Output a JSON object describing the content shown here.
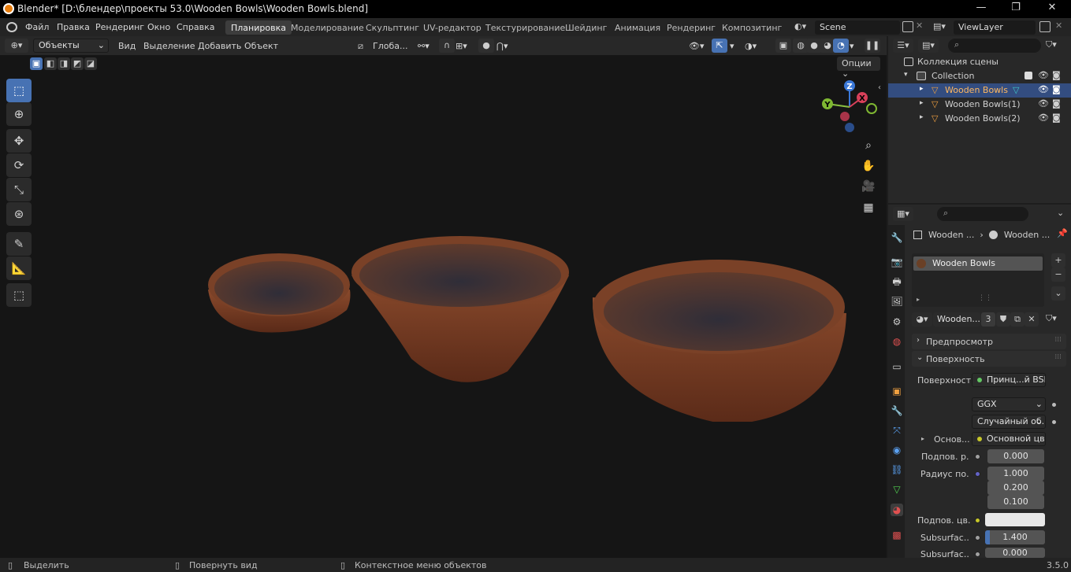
{
  "window": {
    "title": "Blender* [D:\\блендер\\проекты 53.0\\Wooden Bowls\\Wooden Bowls.blend]",
    "minimize": "—",
    "maximize": "❐",
    "close": "✕"
  },
  "menu": [
    "Файл",
    "Правка",
    "Рендеринг",
    "Окно",
    "Справка"
  ],
  "workspaces": [
    "Планировка",
    "Моделирование",
    "Скульптинг",
    "UV-редактор",
    "Текстурирование",
    "Шейдинг",
    "Анимация",
    "Рендеринг",
    "Композитинг"
  ],
  "active_workspace": "Планировка",
  "scene": {
    "name": "Scene",
    "viewlayer": "ViewLayer"
  },
  "viewport": {
    "mode": "Объекты",
    "menus": [
      "Вид",
      "Выделение",
      "Добавить",
      "Объект"
    ],
    "transform_orientation": "Глоба...",
    "options": "Опции",
    "gizmo": {
      "x": "X",
      "y": "Y",
      "z": "Z"
    },
    "bowl_colors": {
      "rim": "#7a4127",
      "inside": "#3e3640",
      "shadow": "#4a2418"
    }
  },
  "tools": [
    "select-box",
    "cursor",
    "move",
    "rotate",
    "scale",
    "transform",
    "annotate",
    "measure",
    "add-cube"
  ],
  "outliner": {
    "scene_collection": "Коллекция сцены",
    "collection": "Collection",
    "items": [
      "Wooden Bowls",
      "Wooden Bowls(1)",
      "Wooden Bowls(2)"
    ],
    "selected": "Wooden Bowls"
  },
  "properties": {
    "breadcrumb_object": "Wooden ...",
    "breadcrumb_material": "Wooden ...",
    "slot_name": "Wooden Bowls",
    "material_name": "Wooden...",
    "user_count": "3",
    "sections": {
      "preview": "Предпросмотр",
      "surface": "Поверхность"
    },
    "surface_label": "Поверхность",
    "surface_value": "Принц...й BSDF",
    "distribution": "GGX",
    "subsurface_method": "Случайный об...",
    "base_label": "Основ...",
    "base_value": "Основной цвет",
    "subsurface_label": "Подпов. р...",
    "subsurface_value": "0.000",
    "radius_label": "Радиус по...",
    "radius_values": [
      "1.000",
      "0.200",
      "0.100"
    ],
    "subsurface_color_label": "Подпов. цв...",
    "subsurface_color": "#e8e8e8",
    "ior_label": "Subsurfac...",
    "ior_value": "1.400",
    "aniso_label": "Subsurfac...",
    "aniso_value": "0.000"
  },
  "status": {
    "select": "Выделить",
    "rotate": "Повернуть вид",
    "context": "Контекстное меню объектов",
    "version": "3.5.0"
  }
}
